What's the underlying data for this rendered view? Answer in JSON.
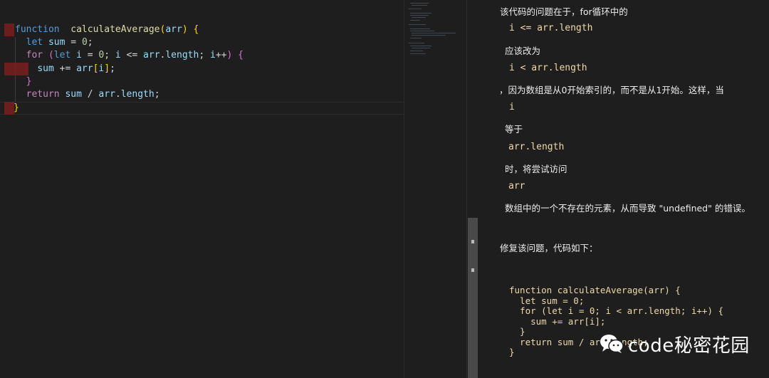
{
  "editor": {
    "lines": [
      {
        "tokens": [
          [
            "dk",
            "function"
          ],
          [
            "",
            "  "
          ],
          [
            "fn",
            "calculateAverage"
          ],
          [
            "br1",
            "("
          ],
          [
            "vr",
            "arr"
          ],
          [
            "br1",
            ")"
          ],
          [
            "",
            " "
          ],
          [
            "brY",
            "{"
          ]
        ]
      },
      {
        "tokens": [
          [
            "",
            "  "
          ],
          [
            "dk",
            "let"
          ],
          [
            "",
            " "
          ],
          [
            "vr",
            "sum"
          ],
          [
            "",
            " = "
          ],
          [
            "nm",
            "0"
          ],
          [
            "",
            ";"
          ]
        ]
      },
      {
        "tokens": [
          [
            "",
            "  "
          ],
          [
            "kw",
            "for"
          ],
          [
            "",
            " "
          ],
          [
            "br2",
            "("
          ],
          [
            "dk",
            "let"
          ],
          [
            "",
            " "
          ],
          [
            "vr",
            "i"
          ],
          [
            "",
            " = "
          ],
          [
            "nm",
            "0"
          ],
          [
            "",
            "; "
          ],
          [
            "vr",
            "i"
          ],
          [
            "",
            " <= "
          ],
          [
            "vr",
            "arr"
          ],
          [
            "",
            "."
          ],
          [
            "vr",
            "length"
          ],
          [
            "",
            "; "
          ],
          [
            "vr",
            "i"
          ],
          [
            "",
            "++"
          ],
          [
            "br2",
            ")"
          ],
          [
            "",
            " "
          ],
          [
            "br2",
            "{"
          ]
        ]
      },
      {
        "tokens": [
          [
            "",
            "    "
          ],
          [
            "vr",
            "sum"
          ],
          [
            "",
            " += "
          ],
          [
            "vr",
            "arr"
          ],
          [
            "br1",
            "["
          ],
          [
            "vr",
            "i"
          ],
          [
            "br1",
            "]"
          ],
          [
            "",
            ";"
          ]
        ]
      },
      {
        "tokens": [
          [
            "",
            "  "
          ],
          [
            "br2",
            "}"
          ]
        ]
      },
      {
        "tokens": [
          [
            "",
            "  "
          ],
          [
            "kw",
            "return"
          ],
          [
            "",
            " "
          ],
          [
            "vr",
            "sum"
          ],
          [
            "",
            " / "
          ],
          [
            "vr",
            "arr"
          ],
          [
            "",
            "."
          ],
          [
            "vr",
            "length"
          ],
          [
            "",
            ";"
          ]
        ]
      },
      {
        "tokens": [
          [
            "brY",
            "}"
          ]
        ]
      }
    ]
  },
  "panel": {
    "p1": "该代码的问题在于，for循环中的",
    "c1": "i <= arr.length",
    "p2": "应该改为",
    "c2": "i < arr.length",
    "p3": "，因为数组是从0开始索引的，而不是从1开始。这样，当",
    "c3": "i",
    "p4": "等于",
    "c4": "arr.length",
    "p5": "时，将尝试访问",
    "c5": "arr",
    "p6": "数组中的一个不存在的元素，从而导致 \"undefined\" 的错误。",
    "p7": "修复该问题，代码如下：",
    "fixed_code": "function calculateAverage(arr) {\n  let sum = 0;\n  for (let i = 0; i < arr.length; i++) {\n    sum += arr[i];\n  }\n  return sum / arr.length;\n}"
  },
  "watermark": {
    "text": "code秘密花园",
    "icon": "wechat-icon"
  },
  "colors": {
    "background": "#1e1e1e",
    "error_highlight": "#7a1f1f",
    "code_text": "#f0d9a8"
  }
}
